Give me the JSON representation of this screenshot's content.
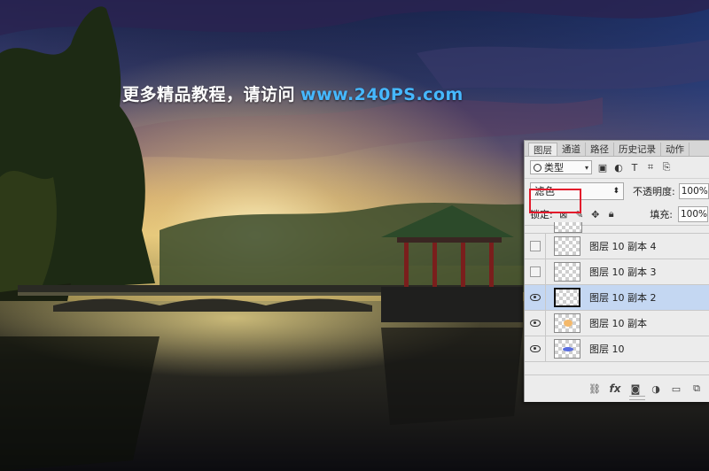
{
  "watermark": {
    "text_cn": "更多精品教程，请访问",
    "url": "www.240PS.com"
  },
  "colors": {
    "url": "#46b8ff",
    "selection_highlight": "#e3192b",
    "selected_row": "#c4d7f2"
  },
  "layers_panel": {
    "tabs": [
      {
        "label": "图层",
        "active": true
      },
      {
        "label": "通道",
        "active": false
      },
      {
        "label": "路径",
        "active": false
      },
      {
        "label": "历史记录",
        "active": false
      },
      {
        "label": "动作",
        "active": false
      }
    ],
    "filter": {
      "label": "类型",
      "icons": [
        "image-filter-icon",
        "adjustment-filter-icon",
        "type-filter-icon",
        "shape-filter-icon",
        "smart-object-filter-icon"
      ]
    },
    "blend_mode": "滤色",
    "opacity_label": "不透明度:",
    "opacity_value": "100%",
    "lock_label": "锁定:",
    "fill_label": "填充:",
    "fill_value": "100%",
    "layers": [
      {
        "name": "图层 10 副本 4",
        "visible": false,
        "selected": false,
        "thumb_color": ""
      },
      {
        "name": "图层 10 副本 3",
        "visible": false,
        "selected": false,
        "thumb_color": ""
      },
      {
        "name": "图层 10 副本 2",
        "visible": true,
        "selected": true,
        "thumb_color": ""
      },
      {
        "name": "图层 10 副本",
        "visible": true,
        "selected": false,
        "thumb_color": "#f3b86a"
      },
      {
        "name": "图层 10",
        "visible": true,
        "selected": false,
        "thumb_color": "#5b6fe0"
      }
    ],
    "bottom_icons": [
      "link-layers-icon",
      "fx-icon",
      "add-mask-icon",
      "adjustment-layer-icon",
      "new-group-icon",
      "new-layer-icon"
    ]
  }
}
